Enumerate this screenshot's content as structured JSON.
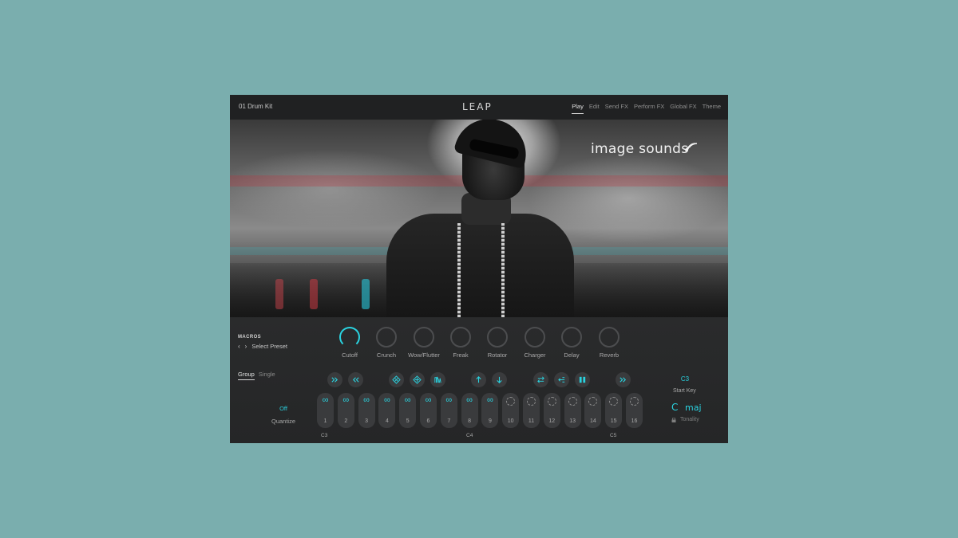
{
  "colors": {
    "accent": "#2ad3e0",
    "background": "#7aaeae",
    "panel": "#1e1f20"
  },
  "header": {
    "preset_name": "01 Drum Kit",
    "logo": "LEAP",
    "tabs": [
      {
        "label": "Play",
        "active": true
      },
      {
        "label": "Edit"
      },
      {
        "label": "Send FX"
      },
      {
        "label": "Perform FX"
      },
      {
        "label": "Global FX"
      },
      {
        "label": "Theme"
      }
    ]
  },
  "hero": {
    "brand": "image sounds",
    "brand_icon": "sound-waves-icon"
  },
  "macros": {
    "title": "MACROS",
    "select_label": "Select Preset",
    "prev_icon": "chevron-left-icon",
    "next_icon": "chevron-right-icon",
    "knobs": [
      {
        "label": "Cutoff",
        "active": true
      },
      {
        "label": "Crunch"
      },
      {
        "label": "Wow/Flutter"
      },
      {
        "label": "Freak"
      },
      {
        "label": "Rotator"
      },
      {
        "label": "Charger"
      },
      {
        "label": "Delay"
      },
      {
        "label": "Reverb"
      }
    ]
  },
  "mode": {
    "tabs": [
      {
        "label": "Group",
        "active": true
      },
      {
        "label": "Single"
      }
    ]
  },
  "toolbar": {
    "icons": [
      "fast-forward-icon",
      "rewind-icon",
      "pattern-a-icon",
      "pattern-b-icon",
      "waveform-icon",
      "arrow-up-icon",
      "arrow-down-icon",
      "swap-icon",
      "reverse-icon",
      "split-icon",
      "fast-forward-icon"
    ]
  },
  "quantize": {
    "value": "Off",
    "label": "Quantize"
  },
  "pads": [
    {
      "number": "1",
      "looped": true
    },
    {
      "number": "2",
      "looped": true
    },
    {
      "number": "3",
      "looped": true
    },
    {
      "number": "4",
      "looped": true
    },
    {
      "number": "5",
      "looped": true
    },
    {
      "number": "6",
      "looped": true
    },
    {
      "number": "7",
      "looped": true
    },
    {
      "number": "8",
      "looped": true
    },
    {
      "number": "9",
      "looped": true
    },
    {
      "number": "10",
      "looped": false
    },
    {
      "number": "11",
      "looped": false
    },
    {
      "number": "12",
      "looped": false
    },
    {
      "number": "13",
      "looped": false
    },
    {
      "number": "14",
      "looped": false
    },
    {
      "number": "15",
      "looped": false
    },
    {
      "number": "16",
      "looped": false
    }
  ],
  "note_labels": [
    "C3",
    "C4",
    "C5"
  ],
  "start_key": {
    "value": "C3",
    "label": "Start Key"
  },
  "tonality": {
    "key": "C",
    "scale": "maj",
    "label": "Tonality"
  }
}
